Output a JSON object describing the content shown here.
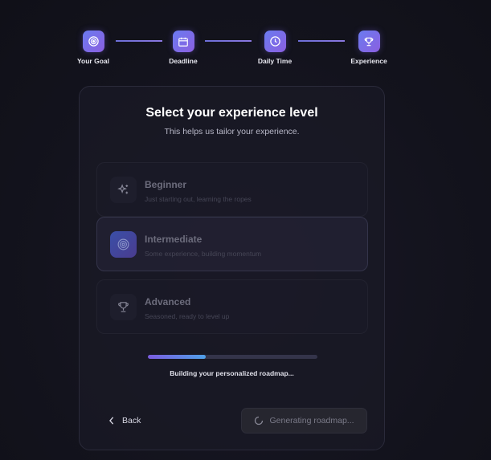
{
  "stepper": {
    "steps": [
      {
        "label": "Your Goal",
        "icon": "target-icon"
      },
      {
        "label": "Deadline",
        "icon": "calendar-icon"
      },
      {
        "label": "Daily Time",
        "icon": "clock-icon"
      },
      {
        "label": "Experience",
        "icon": "trophy-icon"
      }
    ],
    "current_step": 4
  },
  "card": {
    "title": "Select your experience level",
    "subtitle": "This helps us tailor your experience."
  },
  "options": [
    {
      "title": "Beginner",
      "description": "Just starting out, learning the ropes",
      "icon": "sparkles-icon",
      "selected": false
    },
    {
      "title": "Intermediate",
      "description": "Some experience, building momentum",
      "icon": "target-icon",
      "selected": true
    },
    {
      "title": "Advanced",
      "description": "Seasoned, ready to level up",
      "icon": "trophy-icon",
      "selected": false
    }
  ],
  "progress": {
    "value_percent": 34,
    "text": "Building your personalized roadmap..."
  },
  "actions": {
    "back_label": "Back",
    "generate_label": "Generating roadmap..."
  },
  "colors": {
    "accent_start": "#7b5ce0",
    "accent_end": "#4fa0e8",
    "background": "#12121c"
  }
}
